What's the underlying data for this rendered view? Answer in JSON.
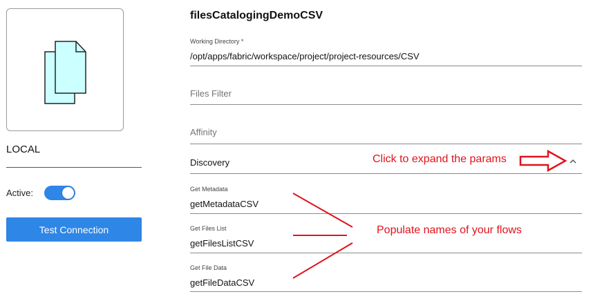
{
  "connection": {
    "name": "LOCAL",
    "active_label": "Active:",
    "active": true,
    "test_button": "Test Connection",
    "icon": "documents-icon"
  },
  "form": {
    "title": "filesCatalogingDemoCSV",
    "working_directory": {
      "label": "Working Directory *",
      "value": "/opt/apps/fabric/workspace/project/project-resources/CSV"
    },
    "files_filter": {
      "placeholder": "Files Filter"
    },
    "affinity": {
      "placeholder": "Affinity"
    },
    "discovery": {
      "label": "Discovery",
      "expanded": true,
      "icon": "chevron-up-icon",
      "fields": [
        {
          "label": "Get Metadata",
          "value": "getMetadataCSV"
        },
        {
          "label": "Get Files List",
          "value": "getFilesListCSV"
        },
        {
          "label": "Get File Data",
          "value": "getFileDataCSV"
        }
      ]
    }
  },
  "annotations": {
    "expand_note": "Click to expand the params",
    "populate_note": "Populate names of your flows",
    "color": "#e0121c"
  },
  "colors": {
    "accent": "#2e86e6",
    "icon_fill": "#ccffff"
  }
}
